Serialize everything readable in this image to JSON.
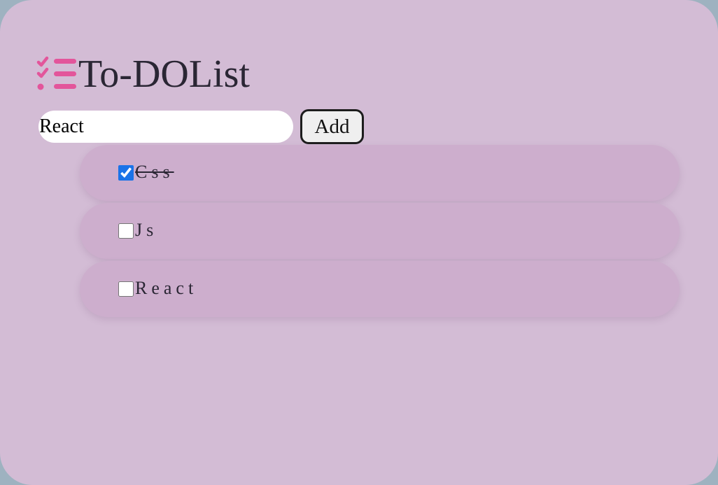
{
  "app": {
    "title": "To-DOList",
    "brand_color": "#e3559b",
    "logo_icon": "checklist-icon"
  },
  "form": {
    "input_value": "React",
    "add_label": "Add"
  },
  "tasks": [
    {
      "label": "Css",
      "done": true
    },
    {
      "label": "Js",
      "done": false
    },
    {
      "label": "React",
      "done": false
    }
  ]
}
